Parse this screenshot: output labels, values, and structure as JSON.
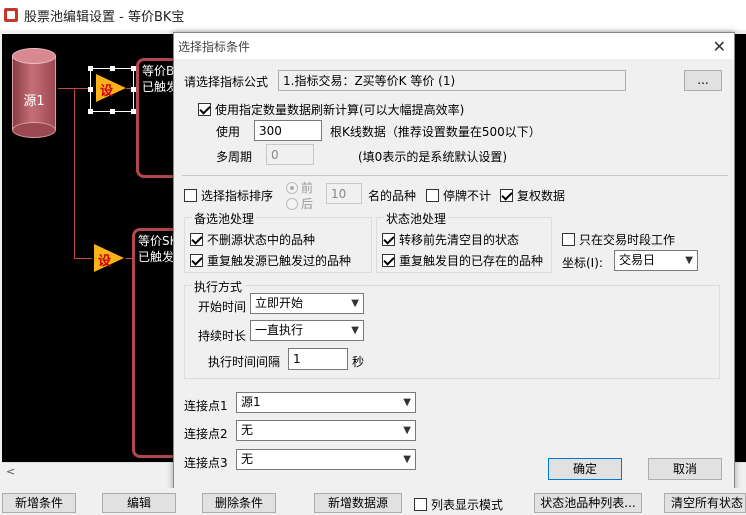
{
  "window": {
    "title": "股票池编辑设置 - 等价BK宝"
  },
  "canvas": {
    "source_label": "源1",
    "node_label": "设",
    "box1_lines": [
      "等价B",
      "已触发"
    ],
    "box2_lines": [
      "等价SK",
      "已触发"
    ]
  },
  "dialog": {
    "title": "选择指标条件",
    "formula_label": "请选择指标公式",
    "formula_value": "1.指标交易：Z买等价K 等价 (1)",
    "formula_button": "...",
    "use_data_checkbox": {
      "label": "使用指定数量数据刷新计算(可以大幅提高效率)",
      "checked": true
    },
    "use_label": "使用",
    "bars_value": "300",
    "bars_suffix": "根K线数据（推荐设置数量在500以下）",
    "multi_period_label": "多周期",
    "multi_period_value": "0",
    "multi_period_note": "(填0表示的是系统默认设置)",
    "sort_checkbox": {
      "label": "选择指标排序",
      "checked": false
    },
    "radio_front": "前",
    "radio_back": "后",
    "sort_count": "10",
    "sort_suffix": "名的品种",
    "suspend_checkbox": {
      "label": "停牌不计",
      "checked": false
    },
    "adjust_checkbox": {
      "label": "复权数据",
      "checked": true
    },
    "candidate_group": {
      "title": "备选池处理",
      "items": [
        {
          "label": "不删源状态中的品种",
          "checked": true
        },
        {
          "label": "重复触发源已触发过的品种",
          "checked": true
        }
      ]
    },
    "status_group": {
      "title": "状态池处理",
      "items": [
        {
          "label": "转移前先清空目的状态",
          "checked": true
        },
        {
          "label": "重复触发目的已存在的品种",
          "checked": true
        }
      ]
    },
    "trade_time_checkbox": {
      "label": "只在交易时段工作",
      "checked": false
    },
    "coord_label": "坐标(I):",
    "coord_value": "交易日",
    "exec_group": {
      "title": "执行方式",
      "start_label": "开始时间",
      "start_value": "立即开始",
      "duration_label": "持续时长",
      "duration_value": "一直执行",
      "interval_label": "执行时间间隔",
      "interval_value": "1",
      "interval_unit": "秒"
    },
    "connections": [
      {
        "label": "连接点1",
        "value": "源1"
      },
      {
        "label": "连接点2",
        "value": "无"
      },
      {
        "label": "连接点3",
        "value": "无"
      }
    ],
    "ok_button": "确定",
    "cancel_button": "取消"
  },
  "toolbar": {
    "add_condition": "新增条件",
    "edit": "编辑",
    "delete_condition": "删除条件",
    "add_source": "新增数据源",
    "list_mode": "列表显示模式",
    "status_list": "状态池品种列表...",
    "clear_all": "清空所有状态"
  }
}
